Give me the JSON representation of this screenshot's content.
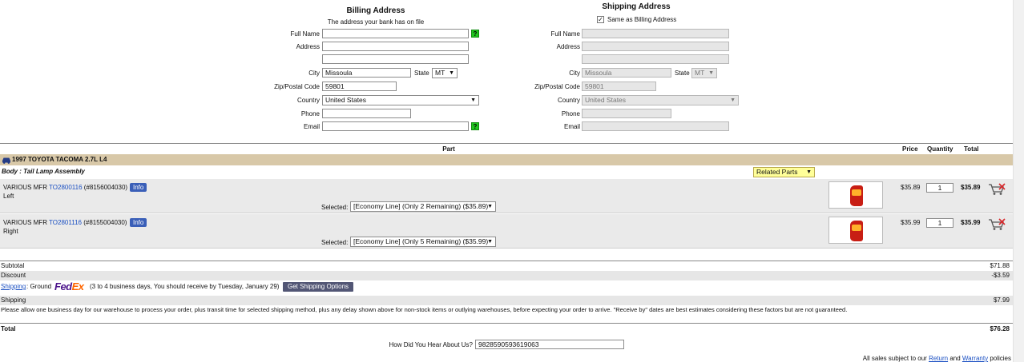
{
  "billing": {
    "title": "Billing Address",
    "subtitle": "The address your bank has on file",
    "labels": {
      "full_name": "Full Name",
      "address": "Address",
      "city": "City",
      "state": "State",
      "zip": "Zip/Postal Code",
      "country": "Country",
      "phone": "Phone",
      "email": "Email"
    },
    "values": {
      "full_name": "",
      "address1": "",
      "address2": "",
      "city": "Missoula",
      "state": "MT",
      "zip": "59801",
      "country": "United States",
      "phone": "",
      "email": ""
    },
    "help_glyph": "?"
  },
  "shipping": {
    "title": "Shipping Address",
    "same_as_billing": "Same as Billing Address",
    "labels": {
      "full_name": "Full Name",
      "address": "Address",
      "city": "City",
      "state": "State",
      "zip": "Zip/Postal Code",
      "country": "Country",
      "phone": "Phone",
      "email": "Email"
    },
    "values": {
      "city": "Missoula",
      "state": "MT",
      "zip": "59801",
      "country": "United States"
    }
  },
  "table": {
    "headers": {
      "part": "Part",
      "price": "Price",
      "quantity": "Quantity",
      "total": "Total"
    },
    "vehicle": "1997 TOYOTA TACOMA 2.7L L4",
    "category": "Body : Tail Lamp Assembly",
    "related_parts": "Related Parts",
    "items": [
      {
        "mfr": "VARIOUS MFR",
        "part": "TO2800116",
        "code": "(#8156004030)",
        "info": "Info",
        "side": "Left",
        "selected_label": "Selected:",
        "selected": "[Economy Line] (Only 2 Remaining) ($35.89)",
        "price": "$35.89",
        "qty": "1",
        "total": "$35.89"
      },
      {
        "mfr": "VARIOUS MFR",
        "part": "TO2801116",
        "code": "(#8155004030)",
        "info": "Info",
        "side": "Right",
        "selected_label": "Selected:",
        "selected": "[Economy Line] (Only 5 Remaining) ($35.99)",
        "price": "$35.99",
        "qty": "1",
        "total": "$35.99"
      }
    ]
  },
  "summary": {
    "subtotal_label": "Subtotal",
    "subtotal": "$71.88",
    "discount_label": "Discount",
    "discount": "-$3.59",
    "shipping_link": "Shipping",
    "shipping_method": ": Ground",
    "carrier_fed": "Fed",
    "carrier_ex": "Ex",
    "shipping_note": "(3 to 4 business days, You should receive by Tuesday, January 29)",
    "get_shipping": "Get Shipping Options",
    "shipping_label": "Shipping",
    "shipping": "$7.99",
    "disclaimer": "Please allow one business day for our warehouse to process your order, plus transit time for selected shipping method, plus any delay shown above for non-stock items or outlying warehouses, before expecting your order to arrive. \"Receive by\" dates are best estimates considering these factors but are not guaranteed.",
    "total_label": "Total",
    "total": "$76.28"
  },
  "hear": {
    "label": "How Did You Hear About Us?",
    "value": "9828590593619063"
  },
  "footer": {
    "prefix": "All sales subject to our",
    "return": "Return",
    "and": "and",
    "warranty": "Warranty",
    "suffix": "policies"
  },
  "colors": {
    "vehicle_bar": "#d8c8a8",
    "row_bg": "#eaeaea",
    "help": "#21c61f",
    "fedex_purple": "#4d148c",
    "fedex_orange": "#ff6600",
    "related_bg": "#ffff99"
  }
}
